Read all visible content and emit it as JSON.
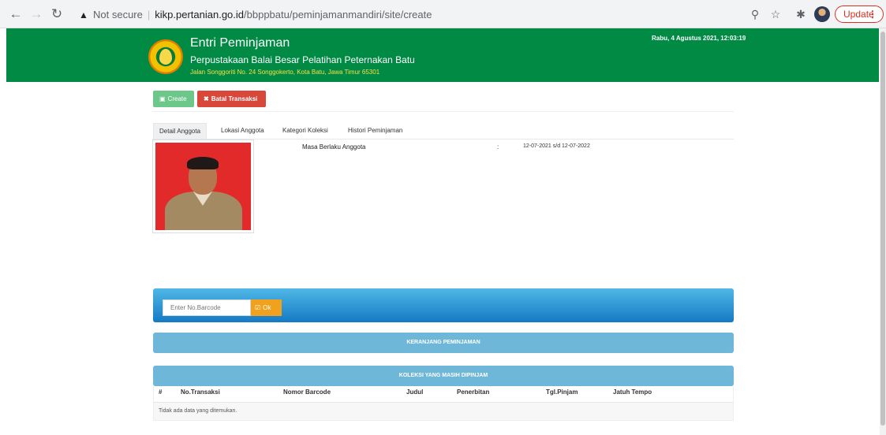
{
  "browser": {
    "not_secure": "Not secure",
    "separator": "|",
    "url_host": "kikp.pertanian.go.id",
    "url_path": "/bbppbatu/peminjamanmandiri/site/create",
    "update_label": "Update"
  },
  "header": {
    "title": "Entri Peminjaman",
    "subtitle": "Perpustakaan Balai Besar Pelatihan Peternakan Batu",
    "address": "Jalan Songgoriti No. 24 Songgokerto, Kota Batu, Jawa Timur 65301",
    "datetime": "Rabu, 4 Agustus 2021, 12:03:19"
  },
  "actions": {
    "create_label": "Create",
    "batal_label": "Batal Transaksi"
  },
  "tabs": [
    {
      "label": "Detail Anggota",
      "active": true
    },
    {
      "label": "Lokasi Anggota",
      "active": false
    },
    {
      "label": "Kategori Koleksi",
      "active": false
    },
    {
      "label": "Histori Peminjaman",
      "active": false
    }
  ],
  "detail": {
    "label": "Masa Berlaku Anggota",
    "colon": ":",
    "value": "12-07-2021 s/d 12-07-2022"
  },
  "barcode": {
    "placeholder": "Enter No.Barcode",
    "ok_label": "Ok"
  },
  "sections": {
    "keranjang": "KERANJANG PEMINJAMAN",
    "koleksi": "KOLEKSI YANG MASIH DIPINJAM"
  },
  "table": {
    "columns": [
      "#",
      "No.Transaksi",
      "Nomor Barcode",
      "Judul",
      "Penerbitan",
      "Tgl.Pinjam",
      "Jatuh Tempo"
    ],
    "empty_text": "Tidak ada data yang ditemukan."
  },
  "colors": {
    "header_green": "#008a44",
    "create_green": "#6ec78a",
    "batal_red": "#d9473b",
    "panel_blue": "#1679c4",
    "section_blue": "#6fb7d8",
    "ok_orange": "#f0a11e"
  },
  "icons": {
    "back": "arrow-left-icon",
    "forward": "arrow-right-icon",
    "reload": "reload-icon",
    "warning": "warning-icon",
    "zoom": "zoom-icon",
    "star": "star-icon",
    "extensions": "puzzle-icon",
    "create": "floppy-icon",
    "batal": "times-icon",
    "ok": "check-square-icon"
  }
}
